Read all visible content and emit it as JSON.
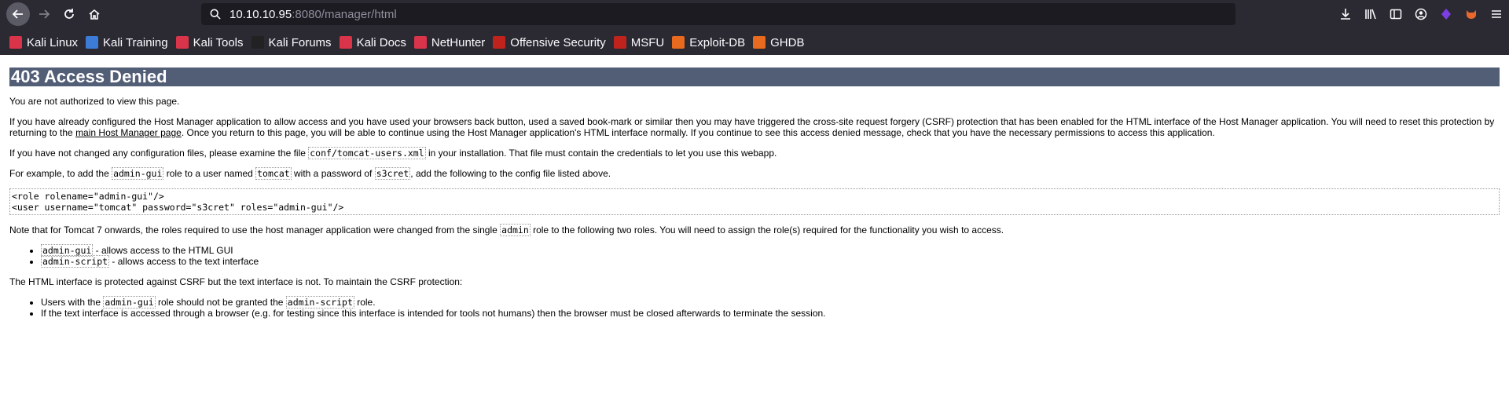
{
  "browser": {
    "url_host": "10.10.10.95",
    "url_rest": ":8080/manager/html",
    "bookmarks": [
      {
        "label": "Kali Linux",
        "color": "#d9344a"
      },
      {
        "label": "Kali Training",
        "color": "#3c7cd8"
      },
      {
        "label": "Kali Tools",
        "color": "#d9344a"
      },
      {
        "label": "Kali Forums",
        "color": "#222"
      },
      {
        "label": "Kali Docs",
        "color": "#d9344a"
      },
      {
        "label": "NetHunter",
        "color": "#d9344a"
      },
      {
        "label": "Offensive Security",
        "color": "#c0221c"
      },
      {
        "label": "MSFU",
        "color": "#c0221c"
      },
      {
        "label": "Exploit-DB",
        "color": "#e76a1e"
      },
      {
        "label": "GHDB",
        "color": "#e76a1e"
      }
    ]
  },
  "page": {
    "title": "403 Access Denied",
    "p1": "You are not authorized to view this page.",
    "p2_a": "If you have already configured the Host Manager application to allow access and you have used your browsers back button, used a saved book-mark or similar then you may have triggered the cross-site request forgery (CSRF) protection that has been enabled for the HTML interface of the Host Manager application. You will need to reset this protection by returning to the ",
    "p2_link": "main Host Manager page",
    "p2_b": ". Once you return to this page, you will be able to continue using the Host Manager application's HTML interface normally. If you continue to see this access denied message, check that you have the necessary permissions to access this application.",
    "p3_a": "If you have not changed any configuration files, please examine the file ",
    "p3_code": "conf/tomcat-users.xml",
    "p3_b": " in your installation. That file must contain the credentials to let you use this webapp.",
    "p4_a": "For example, to add the ",
    "p4_code1": "admin-gui",
    "p4_b": " role to a user named ",
    "p4_code2": "tomcat",
    "p4_c": " with a password of ",
    "p4_code3": "s3cret",
    "p4_d": ", add the following to the config file listed above.",
    "pre_line1": "<role rolename=\"admin-gui\"/>",
    "pre_line2": "<user username=\"tomcat\" password=\"s3cret\" roles=\"admin-gui\"/>",
    "p5_a": "Note that for Tomcat 7 onwards, the roles required to use the host manager application were changed from the single ",
    "p5_code": "admin",
    "p5_b": " role to the following two roles. You will need to assign the role(s) required for the functionality you wish to access.",
    "roles": [
      {
        "code": "admin-gui",
        "text": " - allows access to the HTML GUI"
      },
      {
        "code": "admin-script",
        "text": " - allows access to the text interface"
      }
    ],
    "p6": "The HTML interface is protected against CSRF but the text interface is not. To maintain the CSRF protection:",
    "li1_a": "Users with the ",
    "li1_code1": "admin-gui",
    "li1_b": " role should not be granted the ",
    "li1_code2": "admin-script",
    "li1_c": " role.",
    "li2": "If the text interface is accessed through a browser (e.g. for testing since this interface is intended for tools not humans) then the browser must be closed afterwards to terminate the session."
  }
}
